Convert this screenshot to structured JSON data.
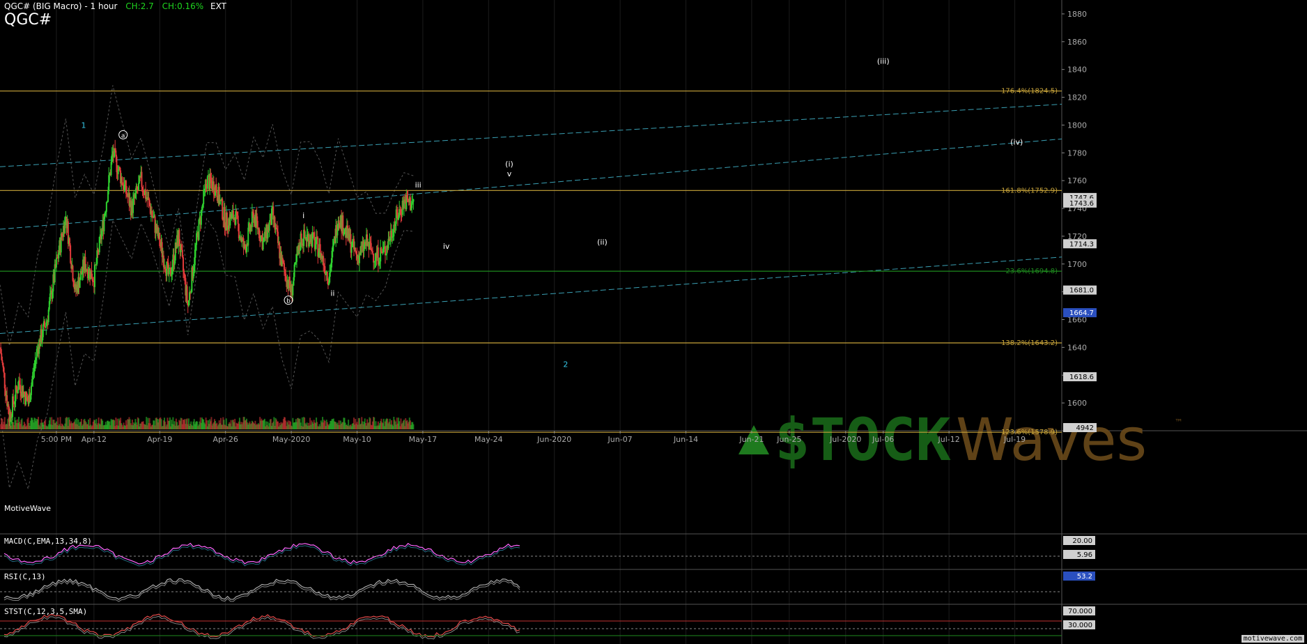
{
  "header": {
    "title": "QGC# (BIG Macro) - 1 hour",
    "ch_points": "CH:2.7",
    "ch_percent": "CH:0.16%",
    "session": "EXT",
    "symbol": "QGC#"
  },
  "brand": "MotiveWave",
  "site": "motivewave.com",
  "logo": {
    "triangle_color": "#1e7a1e",
    "stock": "$TOCK",
    "waves": "Waves",
    "tm": "™"
  },
  "colors": {
    "bg": "#000000",
    "fib": "#c8a43a",
    "green_line": "#1e8a1e",
    "channel": "#3aa0b4",
    "up_candle": "#2fd12f",
    "down_candle": "#e23b3b",
    "label_cyan": "#35c6e6",
    "price_box": "#ffffff",
    "macd": "#ff66ff",
    "macd_hist": "#3cb0d8"
  },
  "chart_data": {
    "type": "candlestick",
    "title": "QGC# (BIG Macro) - 1 hour",
    "ylim": [
      1580,
      1890
    ],
    "yticks": [
      1600,
      1620,
      1640,
      1660,
      1680,
      1700,
      1720,
      1740,
      1760,
      1780,
      1800,
      1820,
      1840,
      1860,
      1880
    ],
    "xticks": [
      {
        "t": 6,
        "label": "5:00 PM"
      },
      {
        "t": 10,
        "label": "Apr-12"
      },
      {
        "t": 17,
        "label": "Apr-19"
      },
      {
        "t": 24,
        "label": "Apr-26"
      },
      {
        "t": 31,
        "label": "May-2020"
      },
      {
        "t": 38,
        "label": "May-10"
      },
      {
        "t": 45,
        "label": "May-17"
      },
      {
        "t": 52,
        "label": "May-24"
      },
      {
        "t": 59,
        "label": "Jun-2020"
      },
      {
        "t": 66,
        "label": "Jun-07"
      },
      {
        "t": 73,
        "label": "Jun-14"
      },
      {
        "t": 80,
        "label": "Jun-21"
      },
      {
        "t": 84,
        "label": "Jun-25"
      },
      {
        "t": 90,
        "label": "Jul-2020"
      },
      {
        "t": 94,
        "label": "Jul-06"
      },
      {
        "t": 101,
        "label": "Jul-12"
      },
      {
        "t": 108,
        "label": "Jul-19"
      }
    ],
    "x_range": [
      0,
      113
    ],
    "price_path": [
      [
        0,
        1640
      ],
      [
        1,
        1590
      ],
      [
        2,
        1615
      ],
      [
        3,
        1600
      ],
      [
        4,
        1640
      ],
      [
        5,
        1660
      ],
      [
        6,
        1700
      ],
      [
        7,
        1735
      ],
      [
        8,
        1680
      ],
      [
        9,
        1700
      ],
      [
        10,
        1690
      ],
      [
        11,
        1730
      ],
      [
        12,
        1780
      ],
      [
        13,
        1760
      ],
      [
        14,
        1740
      ],
      [
        15,
        1760
      ],
      [
        16,
        1740
      ],
      [
        17,
        1715
      ],
      [
        18,
        1690
      ],
      [
        19,
        1720
      ],
      [
        20,
        1670
      ],
      [
        21,
        1720
      ],
      [
        22,
        1760
      ],
      [
        23,
        1755
      ],
      [
        24,
        1730
      ],
      [
        25,
        1735
      ],
      [
        26,
        1710
      ],
      [
        27,
        1735
      ],
      [
        28,
        1715
      ],
      [
        29,
        1735
      ],
      [
        30,
        1700
      ],
      [
        31,
        1680
      ],
      [
        32,
        1718
      ],
      [
        33,
        1720
      ],
      [
        34,
        1710
      ],
      [
        35,
        1690
      ],
      [
        36,
        1735
      ],
      [
        37,
        1720
      ],
      [
        38,
        1705
      ],
      [
        39,
        1715
      ],
      [
        40,
        1705
      ],
      [
        41,
        1710
      ],
      [
        42,
        1730
      ],
      [
        43,
        1745
      ],
      [
        44,
        1743.5
      ]
    ],
    "fib_levels": [
      {
        "label": "176.4%(1824.5)",
        "value": 1824.5
      },
      {
        "label": "161.8%(1752.9)",
        "value": 1752.9
      },
      {
        "label": "23.6%(1694.8)",
        "value": 1694.8
      },
      {
        "label": "138.2%(1643.2)",
        "value": 1643.2
      },
      {
        "label": "123.6%(1578.9)",
        "value": 1578.9
      }
    ],
    "price_markers": [
      {
        "label": "1747.6",
        "value": 1747.6
      },
      {
        "label": "1743.6",
        "value": 1743.6
      },
      {
        "label": "1714.3",
        "value": 1714.3
      },
      {
        "label": "1681.0",
        "value": 1681.0
      },
      {
        "label": "1664.7",
        "value": 1664.7
      },
      {
        "label": "1618.6",
        "value": 1618.6
      },
      {
        "label": "4942",
        "value": 1582
      }
    ],
    "channels": [
      {
        "points": [
          [
            0,
            1770
          ],
          [
            113,
            1815
          ]
        ]
      },
      {
        "points": [
          [
            0,
            1725
          ],
          [
            113,
            1790
          ]
        ]
      },
      {
        "points": [
          [
            0,
            1650
          ],
          [
            113,
            1705
          ]
        ]
      }
    ],
    "wave_labels": [
      {
        "text": "1",
        "t": 8.9,
        "v": 1798,
        "color": "cyan"
      },
      {
        "text": "a",
        "t": 13.1,
        "v": 1791,
        "circle": true
      },
      {
        "text": "b",
        "t": 30.7,
        "v": 1672,
        "circle": true
      },
      {
        "text": "i",
        "t": 32.3,
        "v": 1733
      },
      {
        "text": "ii",
        "t": 35.4,
        "v": 1677
      },
      {
        "text": "iii",
        "t": 44.5,
        "v": 1755
      },
      {
        "text": "iv",
        "t": 47.5,
        "v": 1711
      },
      {
        "text": "(i)",
        "t": 54.2,
        "v": 1770
      },
      {
        "text": "v",
        "t": 54.2,
        "v": 1763
      },
      {
        "text": "(ii)",
        "t": 64.1,
        "v": 1714
      },
      {
        "text": "2",
        "t": 60.2,
        "v": 1626,
        "color": "cyan"
      },
      {
        "text": "(iii)",
        "t": 94,
        "v": 1844
      },
      {
        "text": "(iv)",
        "t": 108.2,
        "v": 1786
      }
    ],
    "indicators": [
      {
        "name": "MACD(C,EMA,13,34,8)",
        "ticks": [
          "20.00",
          "5.96"
        ]
      },
      {
        "name": "RSI(C,13)",
        "ticks": [
          "53.2"
        ]
      },
      {
        "name": "STST(C,12,3,5,SMA)",
        "ticks": [
          "70.000",
          "30.000"
        ]
      }
    ]
  }
}
